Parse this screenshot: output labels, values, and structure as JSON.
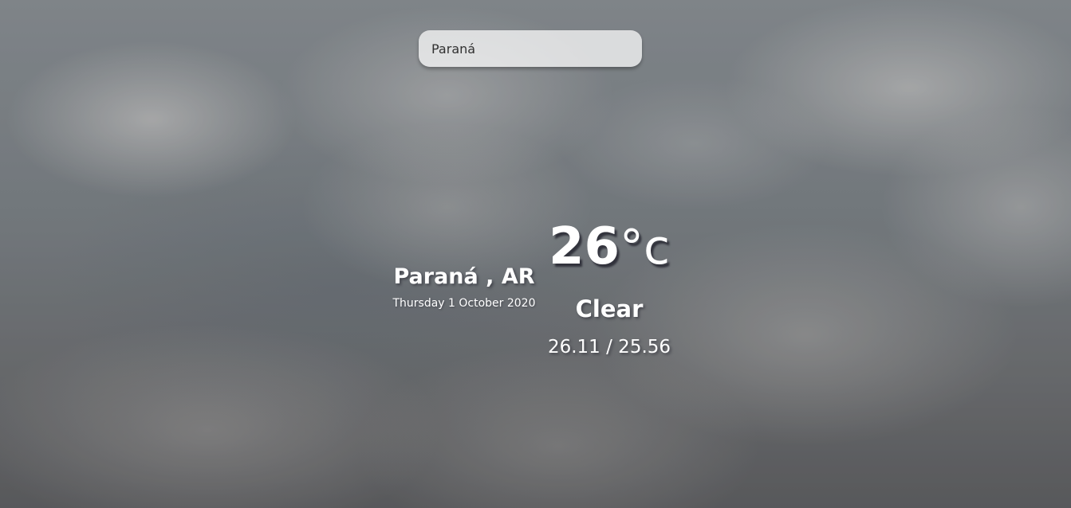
{
  "search": {
    "value": "Paraná",
    "placeholder": ""
  },
  "location": {
    "city": "Paraná",
    "separator": " , ",
    "country": "AR",
    "date": "Thursday 1 October 2020"
  },
  "weather": {
    "temperature": "26",
    "unit": "°c",
    "condition": "Clear",
    "max_min": "26.11 / 25.56"
  },
  "colors": {
    "text": "#ffffff",
    "search_text": "#313131"
  }
}
